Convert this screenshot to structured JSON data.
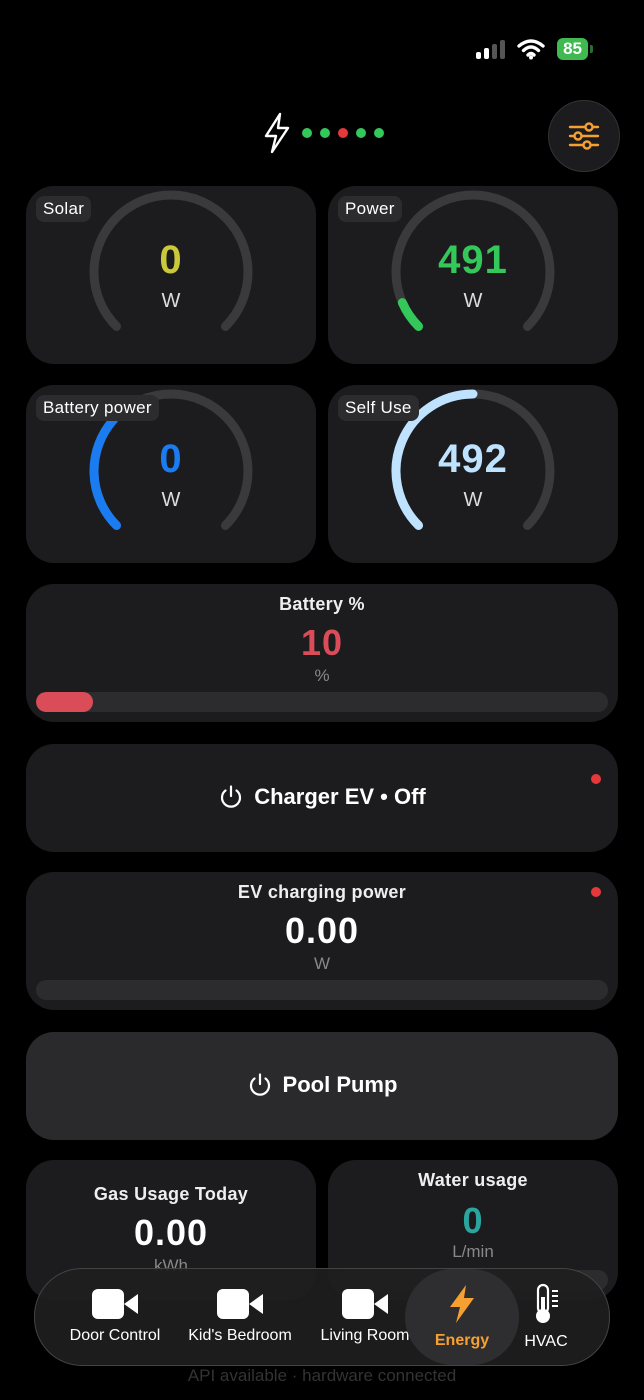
{
  "status": {
    "battery": "85"
  },
  "header": {
    "dot_colors": [
      "#34c759",
      "#34c759",
      "#e5383b",
      "#34c759",
      "#34c759"
    ]
  },
  "gauges": [
    {
      "label": "Solar",
      "value": "0",
      "unit": "W",
      "color": "#c9c93a",
      "fraction": 0
    },
    {
      "label": "Power",
      "value": "491",
      "unit": "W",
      "color": "#34c759",
      "fraction": 0.08
    },
    {
      "label": "Battery  power",
      "value": "0",
      "unit": "W",
      "color": "#1a7cf0",
      "fraction": 0.32
    },
    {
      "label": "Self Use",
      "value": "492",
      "unit": "W",
      "color": "#bfe3ff",
      "fraction": 0.5
    }
  ],
  "battery_percent": {
    "title": "Battery %",
    "value": "10",
    "unit": "%",
    "color": "#d94c58",
    "fraction": 0.1
  },
  "charger_ev": {
    "label": "Charger EV • Off"
  },
  "ev_power": {
    "title": "EV charging power",
    "value": "0.00",
    "unit": "W",
    "fraction": 0
  },
  "pool_pump": {
    "label": "Pool Pump"
  },
  "gas": {
    "title": "Gas Usage Today",
    "value": "0.00",
    "unit": "kWh"
  },
  "water": {
    "title": "Water usage",
    "value": "0",
    "unit": "L/min",
    "color": "#2aa6a0"
  },
  "nav": {
    "items": [
      {
        "label": "Door Control"
      },
      {
        "label": "Kid's Bedroom"
      },
      {
        "label": "Living Room"
      },
      {
        "label": "Energy"
      },
      {
        "label": "HVAC"
      }
    ],
    "accent": "#f5a030"
  },
  "footer": "API available · hardware connected"
}
